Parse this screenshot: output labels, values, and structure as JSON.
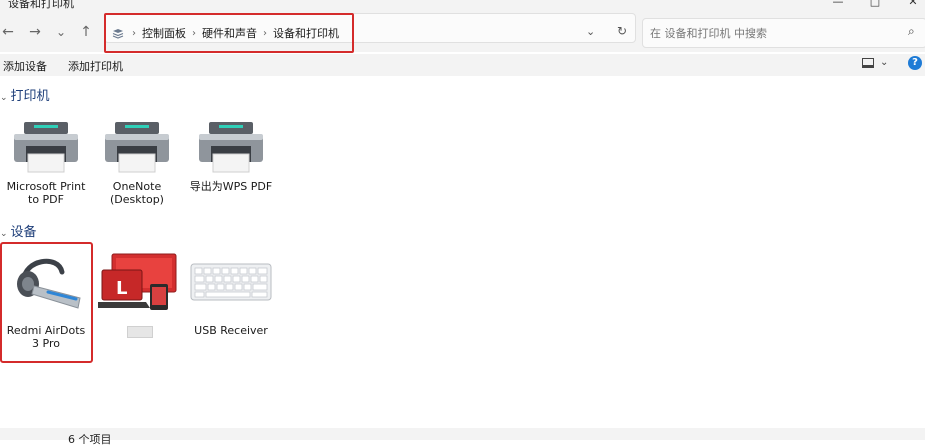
{
  "window": {
    "title": "设备和打印机",
    "minimize_glyph": "—",
    "maximize_glyph": "□",
    "close_glyph": "✕"
  },
  "nav": {
    "back_glyph": "←",
    "forward_glyph": "→",
    "recent_glyph": "⌄",
    "up_glyph": "↑"
  },
  "breadcrumb": {
    "icon": "control-panel-icon",
    "separator": "›",
    "items": [
      "控制面板",
      "硬件和声音",
      "设备和打印机"
    ]
  },
  "address": {
    "dropdown_glyph": "⌄",
    "refresh_glyph": "↻"
  },
  "search": {
    "placeholder": "在 设备和打印机 中搜索",
    "icon_glyph": "⌕"
  },
  "commands": {
    "add_device": "添加设备",
    "add_printer": "添加打印机",
    "view_dropdown_glyph": "⌄",
    "help_glyph": "?"
  },
  "printers": {
    "header": "打印机",
    "items": [
      {
        "label_line1": "Microsoft Print",
        "label_line2": "to PDF",
        "icon": "printer-icon"
      },
      {
        "label_line1": "OneNote",
        "label_line2": "(Desktop)",
        "icon": "printer-icon"
      },
      {
        "label_line1": "导出为WPS PDF",
        "label_line2": "",
        "icon": "printer-icon"
      }
    ]
  },
  "devices": {
    "header": "设备",
    "items": [
      {
        "label_line1": "Redmi AirDots",
        "label_line2": "3 Pro",
        "icon": "bluetooth-headset-icon"
      },
      {
        "label_line1": "",
        "label_line2": "",
        "icon": "computer-icon"
      },
      {
        "label_line1": "USB Receiver",
        "label_line2": "",
        "icon": "keyboard-icon"
      }
    ]
  },
  "status": {
    "item_count": "6 个项目"
  },
  "colors": {
    "accent": "#1e7bd6",
    "highlight_box": "#d42b2b",
    "group_header": "#1f3f7a"
  }
}
